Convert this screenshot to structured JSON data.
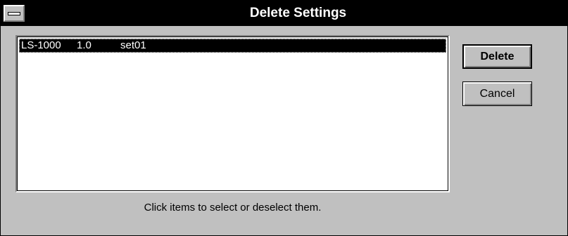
{
  "window": {
    "title": "Delete Settings"
  },
  "list": {
    "items": [
      {
        "model": "LS-1000",
        "version": "1.0",
        "name": "set01",
        "selected": true
      }
    ]
  },
  "hint": "Click items to select or deselect them.",
  "buttons": {
    "delete_label": "Delete",
    "cancel_label": "Cancel"
  },
  "colors": {
    "face": "#c0c0c0",
    "titlebar": "#000000",
    "selection": "#000000"
  }
}
